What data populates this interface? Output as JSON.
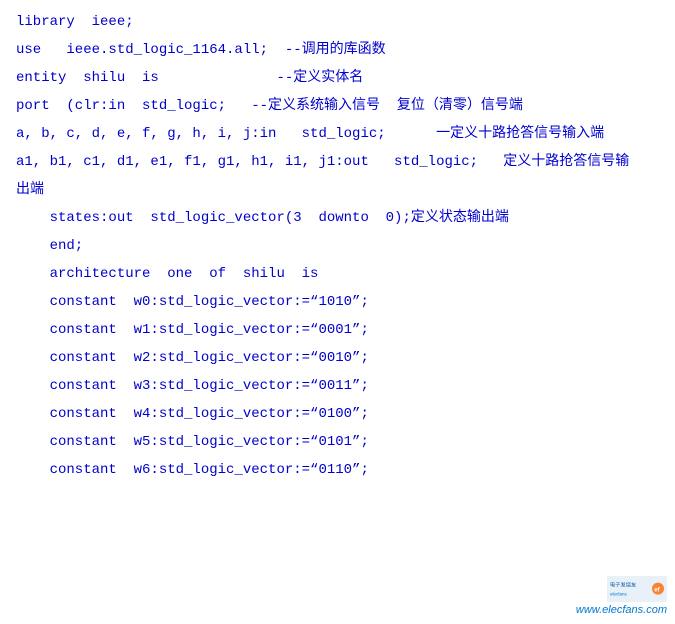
{
  "code": {
    "lines": [
      {
        "id": "line1",
        "text": "library  ieee;"
      },
      {
        "id": "line2",
        "text": "use   ieee.std_logic_1164.all;  --调用的库函数"
      },
      {
        "id": "line3",
        "text": "entity  shilu  is              --定义实体名"
      },
      {
        "id": "line4",
        "text": "port  (clr:in  std_logic;   --定义系统输入信号  复位（清零）信号端"
      },
      {
        "id": "line5",
        "text": "a, b, c, d, e, f, g, h, i, j:in   std_logic;      一定义十路抢答信号输入端"
      },
      {
        "id": "line6",
        "text": "a1, b1, c1, d1, e1, f1, g1, h1, i1, j1:out   std_logic;   定义十路抢答信号输"
      },
      {
        "id": "line7",
        "text": "出端"
      },
      {
        "id": "line8",
        "text": "    states:out  std_logic_vector(3  downto  0);定义状态输出端"
      },
      {
        "id": "line9",
        "text": "    end;"
      },
      {
        "id": "line10",
        "text": "    architecture  one  of  shilu  is"
      },
      {
        "id": "line11",
        "text": "    constant  w0:std_logic_vector:=\"1010\";"
      },
      {
        "id": "line12",
        "text": "    constant  w1:std_logic_vector:=\"0001\";"
      },
      {
        "id": "line13",
        "text": "    constant  w2:std_logic_vector:=\"0010\";"
      },
      {
        "id": "line14",
        "text": "    constant  w3:std_logic_vector:=\"0011\";"
      },
      {
        "id": "line15",
        "text": "    constant  w4:std_logic_vector:=\"0100\";"
      },
      {
        "id": "line16",
        "text": "    constant  w5:std_logic_vector:=\"0101\";"
      },
      {
        "id": "line17",
        "text": "    constant  w6:std_logic_vector:=\"0110\";"
      }
    ]
  },
  "watermark": {
    "url_text": "www.elecfans.com",
    "logo_text": "电子发烧友"
  }
}
